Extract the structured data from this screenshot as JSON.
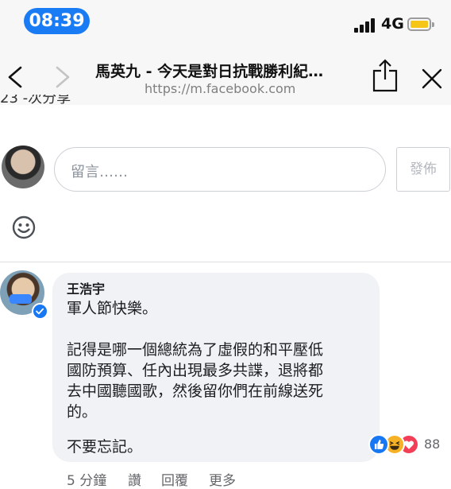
{
  "status_bar": {
    "time": "08:39",
    "network": "4G"
  },
  "browser": {
    "page_title": "馬英九 - 今天是對日抗戰勝利紀…",
    "url": "https://m.facebook.com",
    "icons": [
      "back-icon",
      "forward-icon",
      "share-icon",
      "close-icon"
    ]
  },
  "previous_comment_cutoff": "23 -次分享",
  "comment_box": {
    "placeholder": "留言……",
    "post_label": "發佈",
    "emoji_icon": "smiley-icon"
  },
  "comment": {
    "author": "王浩宇",
    "verified": true,
    "lines": [
      "軍人節快樂。",
      "",
      "記得是哪一個總統為了虛假的和平壓低",
      "國防預算、任內出現最多共諜，退將都",
      "去中國聽國歌，然後留你們在前線送死",
      "的。",
      "",
      "不要忘記。"
    ],
    "reactions": {
      "types": [
        "like",
        "haha",
        "love"
      ],
      "count": "88"
    },
    "actions": {
      "time": "5 分鐘",
      "like": "讚",
      "reply": "回覆",
      "more": "更多"
    }
  },
  "colors": {
    "time_pill": "#1a7cf4",
    "bubble": "#f0f2f5",
    "battery": "#f5c518",
    "verified": "#1877f2",
    "like": "#1877f2",
    "haha": "#f7b125",
    "love": "#f33e58"
  }
}
